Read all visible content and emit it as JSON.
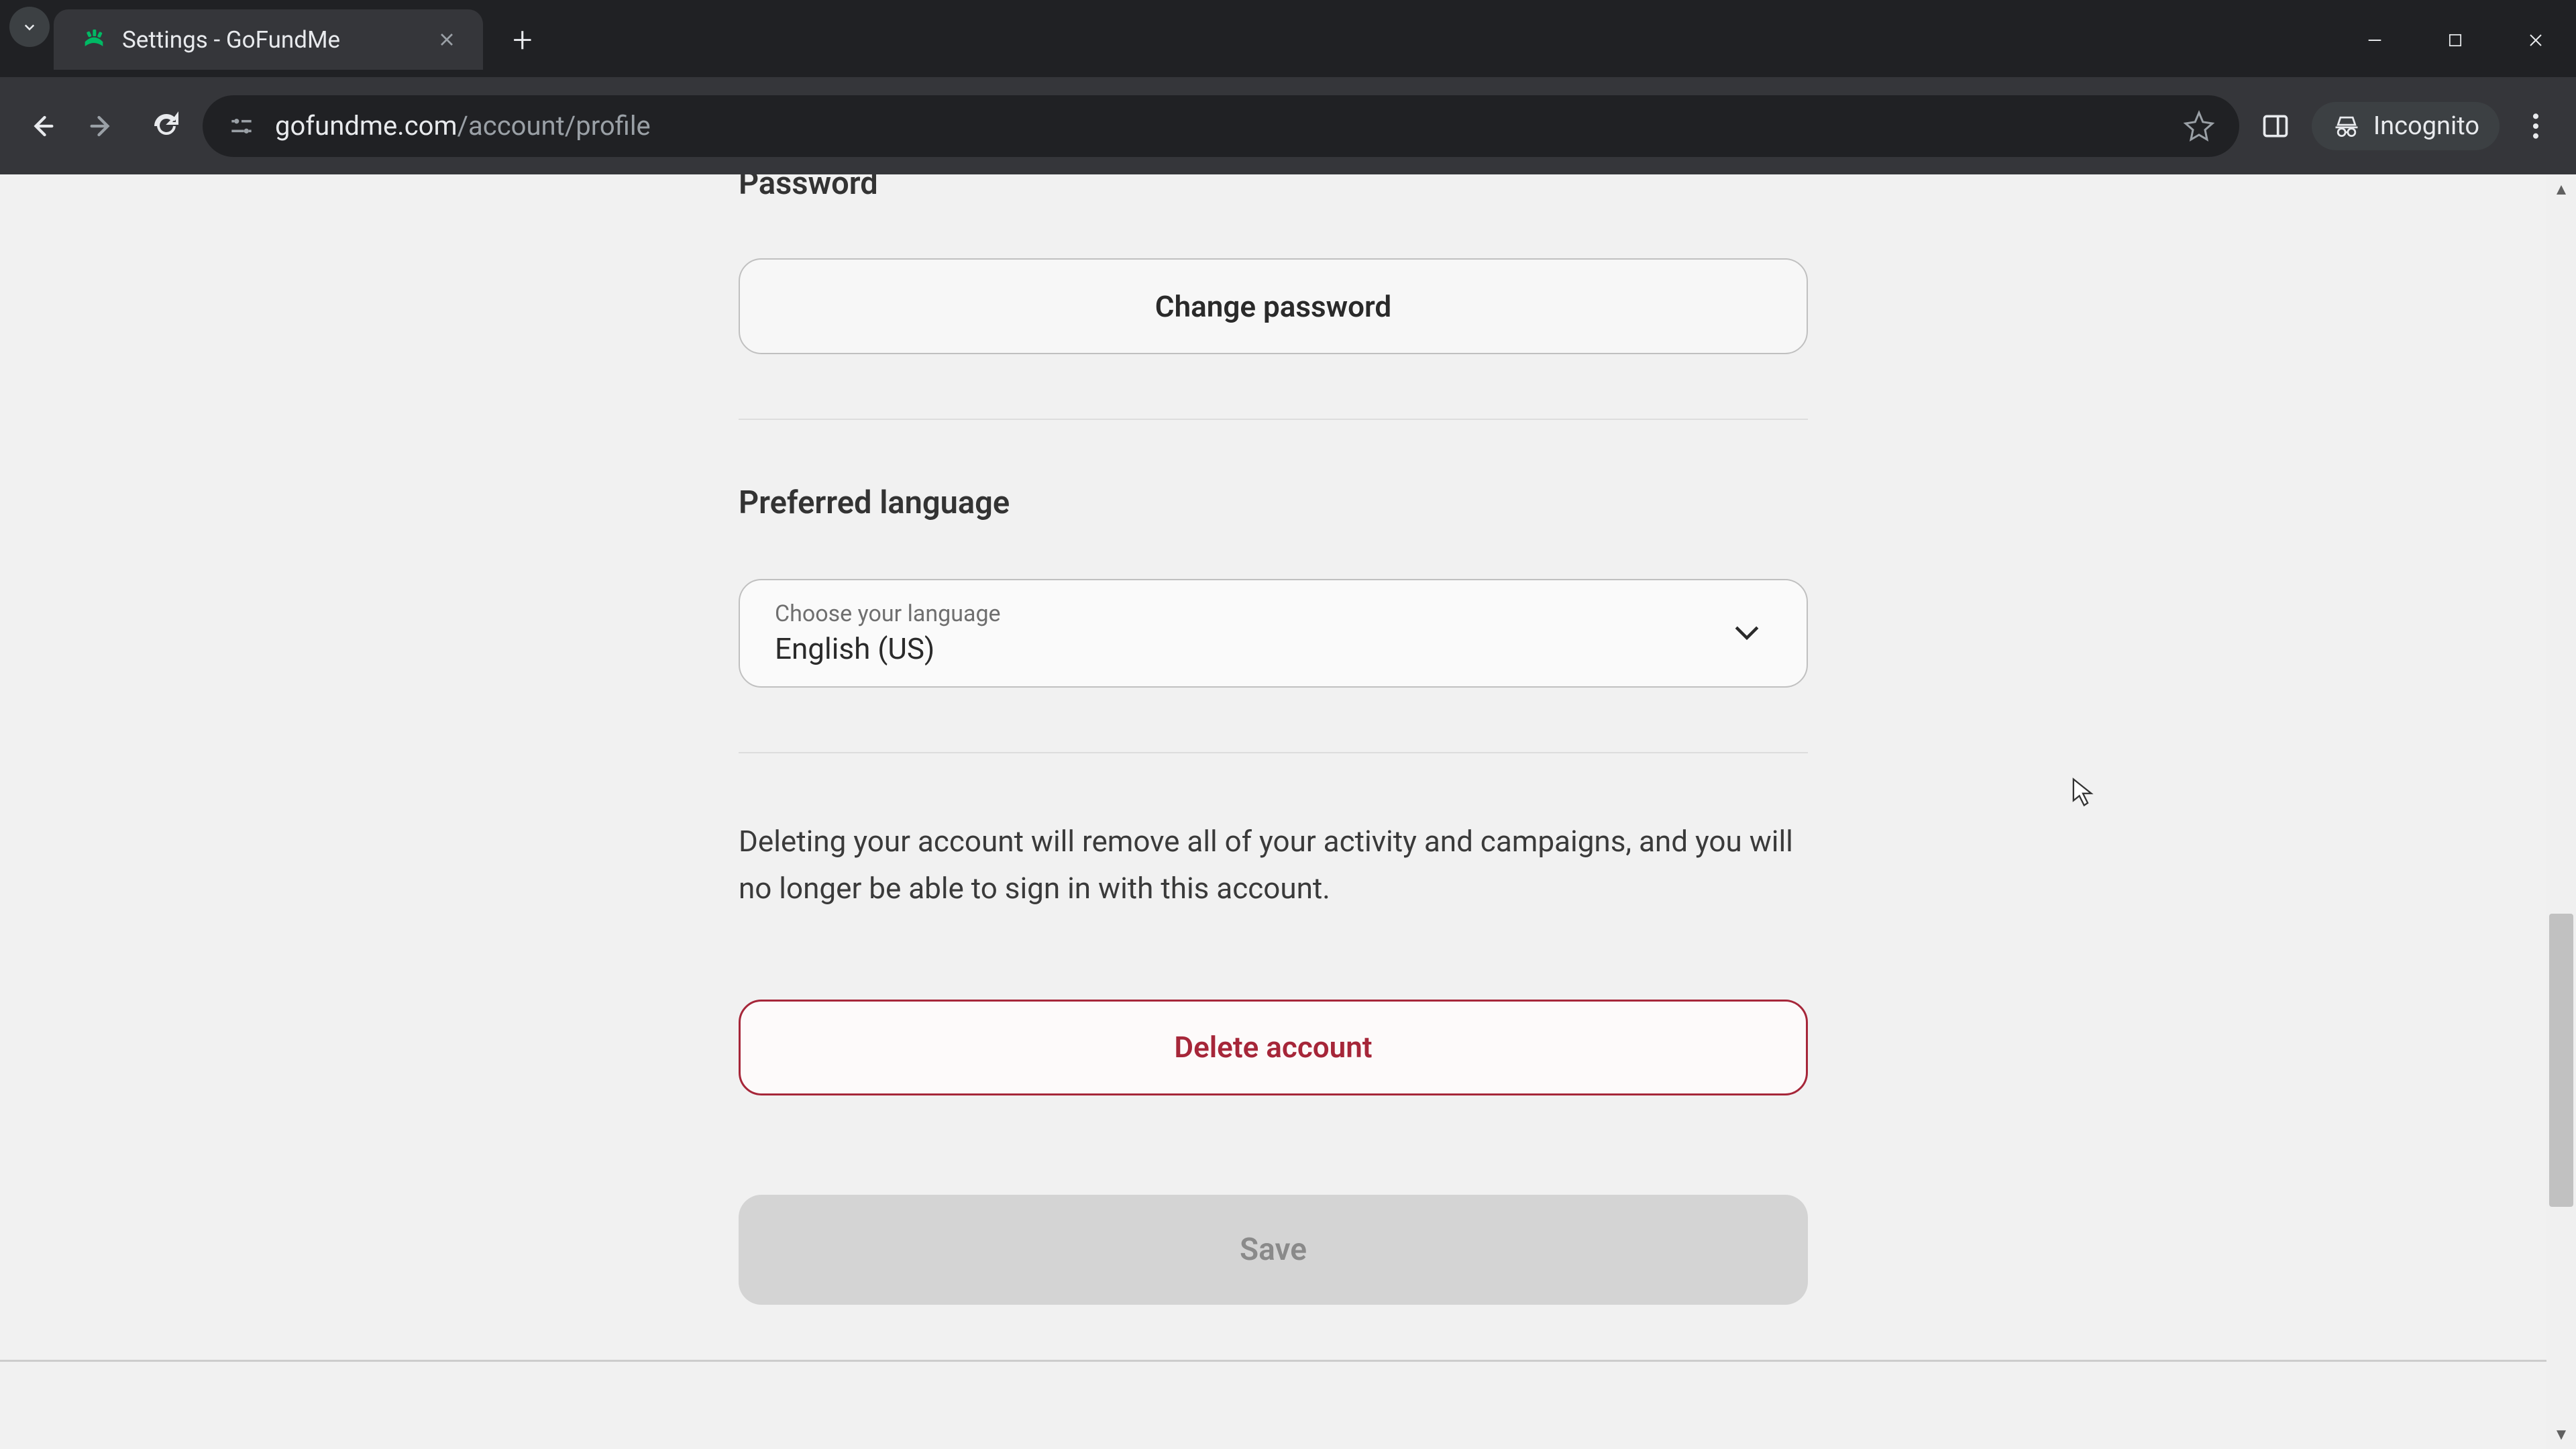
{
  "browser": {
    "tab_title": "Settings - GoFundMe",
    "url_domain": "gofundme.com",
    "url_path": "/account/profile",
    "incognito_label": "Incognito"
  },
  "page": {
    "password_section_label": "Password",
    "change_password_label": "Change password",
    "language_section_label": "Preferred language",
    "language_hint": "Choose your language",
    "language_value": "English (US)",
    "delete_description": "Deleting your account will remove all of your activity and campaigns, and you will no longer be able to sign in with this account.",
    "delete_button_label": "Delete account",
    "save_button_label": "Save"
  }
}
